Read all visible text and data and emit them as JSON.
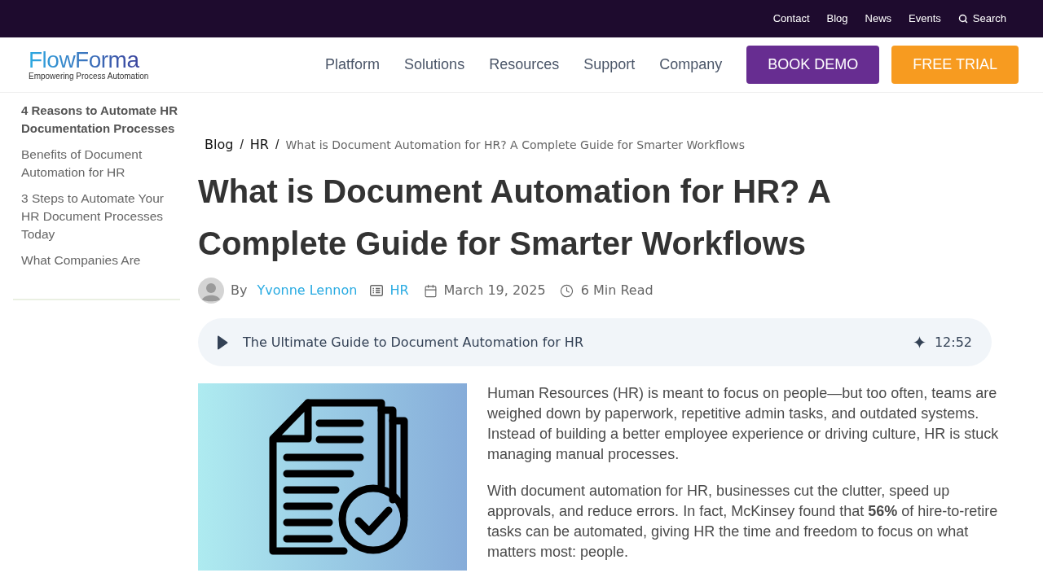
{
  "top_bar": {
    "links": [
      "Contact",
      "Blog",
      "News",
      "Events"
    ],
    "search": {
      "label": "Search"
    }
  },
  "header": {
    "logo": {
      "name": "FlowForma",
      "tagline": "Empowering Process Automation"
    },
    "nav": [
      "Platform",
      "Solutions",
      "Resources",
      "Support",
      "Company"
    ],
    "buttons": [
      {
        "label": "BOOK DEMO",
        "kind": "primary"
      },
      {
        "label": "FREE TRIAL",
        "kind": "secondary"
      }
    ]
  },
  "sidebar": {
    "items": [
      {
        "label": "4 Reasons to Automate HR Documentation Processes",
        "selected": true
      },
      {
        "label": "Benefits of Document Automation for HR",
        "selected": false
      },
      {
        "label": "3 Steps to Automate Your HR Document Processes Today",
        "selected": false
      },
      {
        "label": "What Companies Are",
        "selected": false
      }
    ]
  },
  "breadcrumb": {
    "separator": "/",
    "items": [
      {
        "label": "Blog",
        "kind": "link"
      },
      {
        "label": "HR",
        "kind": "link"
      },
      {
        "label": "What is Document Automation for HR? A Complete Guide for Smarter Workflows",
        "kind": "current"
      }
    ]
  },
  "article": {
    "title": "What is Document Automation for HR? A Complete Guide for Smarter Workflows",
    "meta": {
      "by": "By",
      "author": "Yvonne Lennon",
      "category": "HR",
      "date": "March 19, 2025",
      "read_time": "6 Min Read"
    },
    "audio_player": {
      "title": "The Ultimate Guide to Document Automation for HR",
      "duration": "12:52"
    },
    "paragraphs": [
      "Human Resources (HR) is meant to focus on people—but too often, teams are weighed down by paperwork, repetitive admin tasks, and outdated systems. Instead of building a better employee experience or driving culture, HR is stuck managing manual processes.",
      "With document automation for HR, businesses cut the clutter, speed up approvals, and reduce errors. In fact, McKinsey found that **56%** of hire-to-retire tasks can be automated, giving HR the time and freedom to focus on what matters most: people."
    ]
  }
}
